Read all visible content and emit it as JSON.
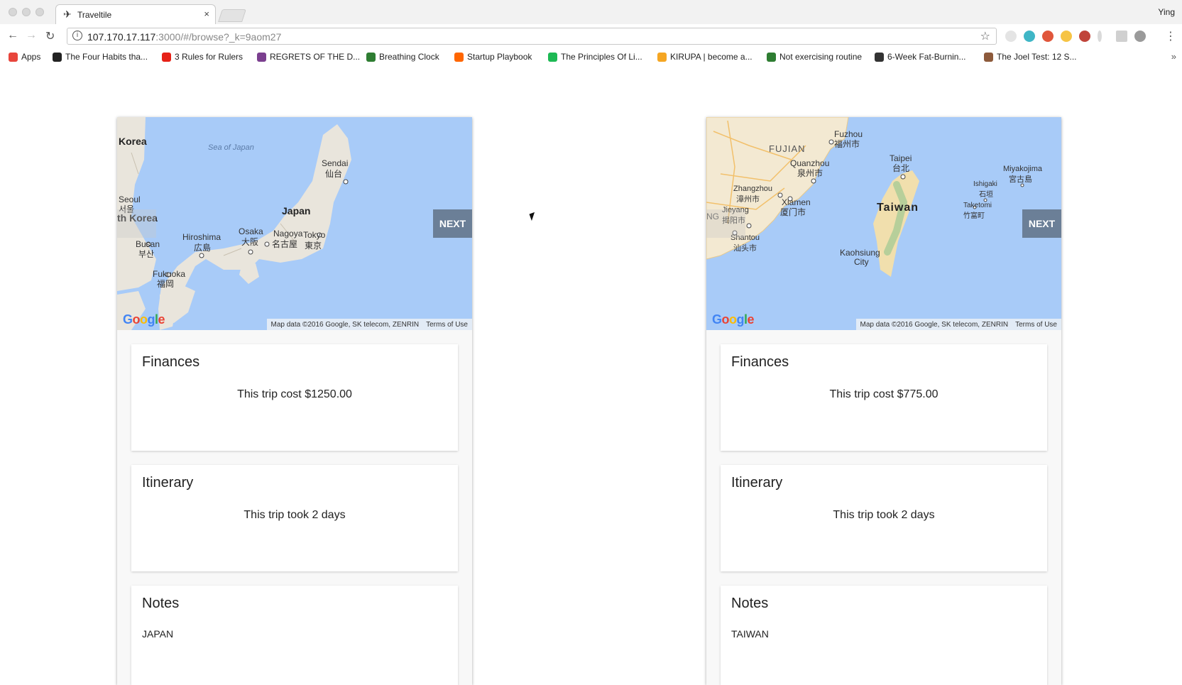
{
  "browser": {
    "tab_title": "Traveltile",
    "tab_close": "×",
    "tab_favicon": "✈",
    "profile_name": "Ying",
    "url_host": "107.170.17.117",
    "url_path": ":3000/#/browse?_k=9aom27",
    "nav": {
      "back": "←",
      "forward": "→",
      "reload": "↻",
      "star": "☆",
      "menu": "⋮",
      "info": "i"
    },
    "bookmarks": [
      {
        "label": "Apps",
        "color": "#e8453c"
      },
      {
        "label": "The Four Habits tha...",
        "color": "#222222"
      },
      {
        "label": "3 Rules for Rulers",
        "color": "#e62117"
      },
      {
        "label": "REGRETS OF THE D...",
        "color": "#7b3f8f"
      },
      {
        "label": "Breathing Clock",
        "color": "#2e7d32"
      },
      {
        "label": "Startup Playbook",
        "color": "#ff6600"
      },
      {
        "label": "The Principles Of Li...",
        "color": "#1db954"
      },
      {
        "label": "KIRUPA | become a...",
        "color": "#f5a623"
      },
      {
        "label": "Not exercising routine",
        "color": "#2e7d32"
      },
      {
        "label": "6-Week Fat-Burnin...",
        "color": "#333333"
      },
      {
        "label": "The Joel Test: 12 S...",
        "color": "#8d5a3b"
      }
    ],
    "bookmarks_more": "»"
  },
  "trips": [
    {
      "map": {
        "labels": {
          "korea": "Korea",
          "sea": "Sea of Japan",
          "sendai": "Sendai",
          "sendai_local": "仙台",
          "japan": "Japan",
          "seoul": "Seoul",
          "seoul_local": "서울",
          "south_korea": "th Korea",
          "hiroshima": "Hiroshima",
          "hiroshima_local": "広島",
          "osaka": "Osaka",
          "osaka_local": "大阪",
          "nagoya": "Nagoya",
          "nagoya_local": "名古屋",
          "tokyo": "Tokyo",
          "tokyo_local": "東京",
          "busan": "Busan",
          "busan_local": "부산",
          "fukuoka": "Fukuoka",
          "fukuoka_local": "福岡"
        },
        "google": "Google",
        "attribution": "Map data ©2016 Google, SK telecom, ZENRIN",
        "terms": "Terms of Use"
      },
      "next_label": "NEXT",
      "finances_title": "Finances",
      "finances_text": "This trip cost $1250.00",
      "itinerary_title": "Itinerary",
      "itinerary_text": "This trip took 2 days",
      "notes_title": "Notes",
      "notes_text": "JAPAN"
    },
    {
      "map": {
        "labels": {
          "fuzhou": "Fuzhou",
          "fuzhou_local": "福州市",
          "fujian": "FUJIAN",
          "quanzhou": "Quanzhou",
          "quanzhou_local": "泉州市",
          "taipei": "Taipei",
          "taipei_local": "台北",
          "miyakojima": "Miyakojima",
          "miyakojima_local": "宮古島",
          "zhangzhou": "Zhangzhou",
          "zhangzhou_local": "漳州市",
          "xiamen": "Xiamen",
          "xiamen_local": "厦门市",
          "taiwan": "Taiwan",
          "ishigaki": "Ishigaki",
          "ishigaki_local": "石垣",
          "taketomi": "Taketomi",
          "taketomi_local": "竹富町",
          "jieyang": "Jieyang",
          "jieyang_local": "揭阳市",
          "ng": "NG",
          "shantou": "Shantou",
          "shantou_local": "汕头市",
          "kaohsiung": "Kaohsiung",
          "kaohsiung_city": "City"
        },
        "google": "Google",
        "attribution": "Map data ©2016 Google, SK telecom, ZENRIN",
        "terms": "Terms of Use"
      },
      "next_label": "NEXT",
      "finances_title": "Finances",
      "finances_text": "This trip cost $775.00",
      "itinerary_title": "Itinerary",
      "itinerary_text": "This trip took 2 days",
      "notes_title": "Notes",
      "notes_text": "TAIWAN"
    }
  ]
}
